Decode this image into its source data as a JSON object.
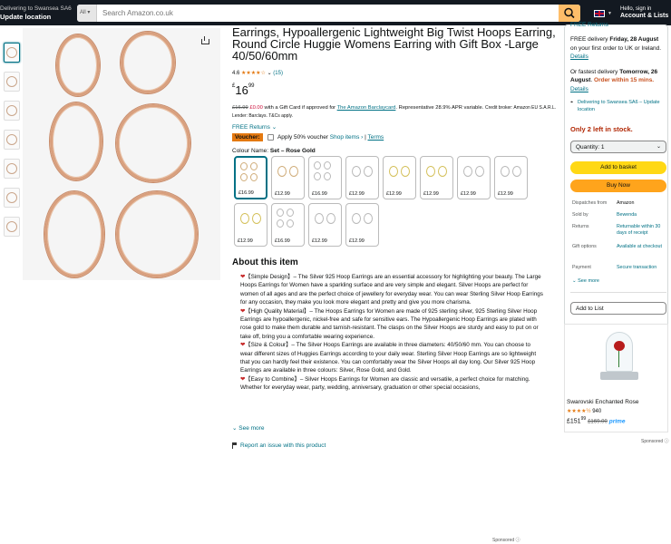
{
  "nav": {
    "deliver_line1": "Delivering to Swansea SA6",
    "deliver_line2": "Update location",
    "search_category": "All",
    "search_placeholder": "Search Amazon.co.uk",
    "account_line1": "Hello, sign in",
    "account_line2": "Account & Lists"
  },
  "product": {
    "title": "Earrings, Hypoallergenic Lightweight Big Twist Hoops Earring, Round Circle Huggie Womens Earring with Gift Box -Large 40/50/60mm",
    "rating_value": "4.6",
    "stars": "★★★★☆",
    "rating_count": "(15)",
    "price_currency": "£",
    "price_whole": "16",
    "price_fraction": "99",
    "gc_old_price": "£16.99",
    "gc_new_price": "£0.00",
    "gc_text1": "with a Gift Card if approved for",
    "gc_link": "The Amazon Barclaycard",
    "gc_text2": ". Representative 28.9% APR variable.",
    "gc_text3": "Credit broker: Amazon EU S.A.R.L. Lender: Barclays. T&Cs apply.",
    "free_returns": "FREE Returns",
    "voucher_badge": "Voucher:",
    "voucher_text": "Apply 50% voucher",
    "shop_items": "Shop items ›",
    "terms": "Terms",
    "colour_label": "Colour Name:",
    "colour_value": "Set – Rose Gold",
    "swatches": [
      {
        "price": "£16.99"
      },
      {
        "price": "£12.99"
      },
      {
        "price": "£16.99"
      },
      {
        "price": "£12.99"
      },
      {
        "price": "£12.99"
      },
      {
        "price": "£12.99"
      },
      {
        "price": "£12.99"
      },
      {
        "price": "£12.99"
      },
      {
        "price": "£12.99"
      },
      {
        "price": "£16.99"
      },
      {
        "price": "£12.99"
      },
      {
        "price": "£12.99"
      }
    ]
  },
  "about": {
    "heading": "About this item",
    "bullets": [
      "【Simple Design】– The Silver 925 Hoop Earrings are an essential accessory for highlighting your beauty. The Large Hoops Earrings for Women have a sparkling surface and are very simple and elegant. Silver Hoops are perfect for women of all ages and are the perfect choice of jewellery for everyday wear. You can wear Sterling Silver Hoop Earrings for any occasion, they make you look more elegant and pretty and give you more charisma.",
      "【High Quality Material】– The Hoops Earrings for Women are made of 925 sterling silver, 925 Sterling Silver Hoop Earrings are hypoallergenic, nickel-free and safe for sensitive ears. The Hypoallergenic Hoop Earrings are plated with rose gold to make them durable and tarnish-resistant. The clasps on the Silver Hoops are sturdy and easy to put on or take off, bring you a comfortable wearing experience.",
      "【Size & Colour】– The Silver Hoops Earrings are available in three diameters: 40/50/60 mm. You can choose to wear different sizes of Huggies Earrings according to your daily wear. Sterling Silver Hoop Earrings are so lightweight that you can hardly feel their existence. You can comfortably wear the Silver Hoops all day long. Our Silver 925 Hoop Earrings are available in three colours: Silver, Rose Gold, and Gold.",
      "【Easy to Combine】– Silver Hoops Earrings for Women are classic and versatile, a perfect choice for matching. Whether for everyday wear, party, wedding, anniversary, graduation or other special occasions,"
    ],
    "see_more": "See more",
    "report": "Report an issue with this product",
    "sponsored": "Sponsored"
  },
  "buybox": {
    "free_returns_top": "FREE Returns",
    "free_delivery": "FREE delivery",
    "delivery_date": "Friday, 28 August",
    "delivery_rest": "on your first order to UK or Ireland.",
    "details": "Details",
    "fastest_prefix": "Or fastest delivery",
    "fastest_date": "Tomorrow, 26 August",
    "order_within": "Order within 15 mins.",
    "details2": "Details",
    "location_link": "Delivering to Swansea SA6 – Update location",
    "only_left": "Only 2 left in stock.",
    "quantity": "Quantity: 1",
    "add_to_basket": "Add to basket",
    "buy_now": "Buy Now",
    "info": [
      {
        "k": "Dispatches from",
        "v": "Amazon"
      },
      {
        "k": "Sold by",
        "v": "Bewenda"
      },
      {
        "k": "Returns",
        "v": "Returnable within 30 days of receipt"
      },
      {
        "k": "Gift options",
        "v": "Available at checkout"
      },
      {
        "k": "Payment",
        "v": "Secure transaction"
      }
    ],
    "see_more": "See more",
    "add_to_list": "Add to List"
  },
  "ad": {
    "title": "Swarovski Enchanted Rose",
    "stars": "★★★★½",
    "count": "940",
    "price": "£151",
    "price_frac": "99",
    "old_price": "£169.00",
    "prime": "prime",
    "sponsored": "Sponsored"
  },
  "colors": {
    "nav_bg": "#131921",
    "search_button": "#febd69",
    "add_to_basket": "#ffd814",
    "buy_now": "#ffa41c",
    "link": "#007185",
    "stock_red": "#b12704"
  }
}
